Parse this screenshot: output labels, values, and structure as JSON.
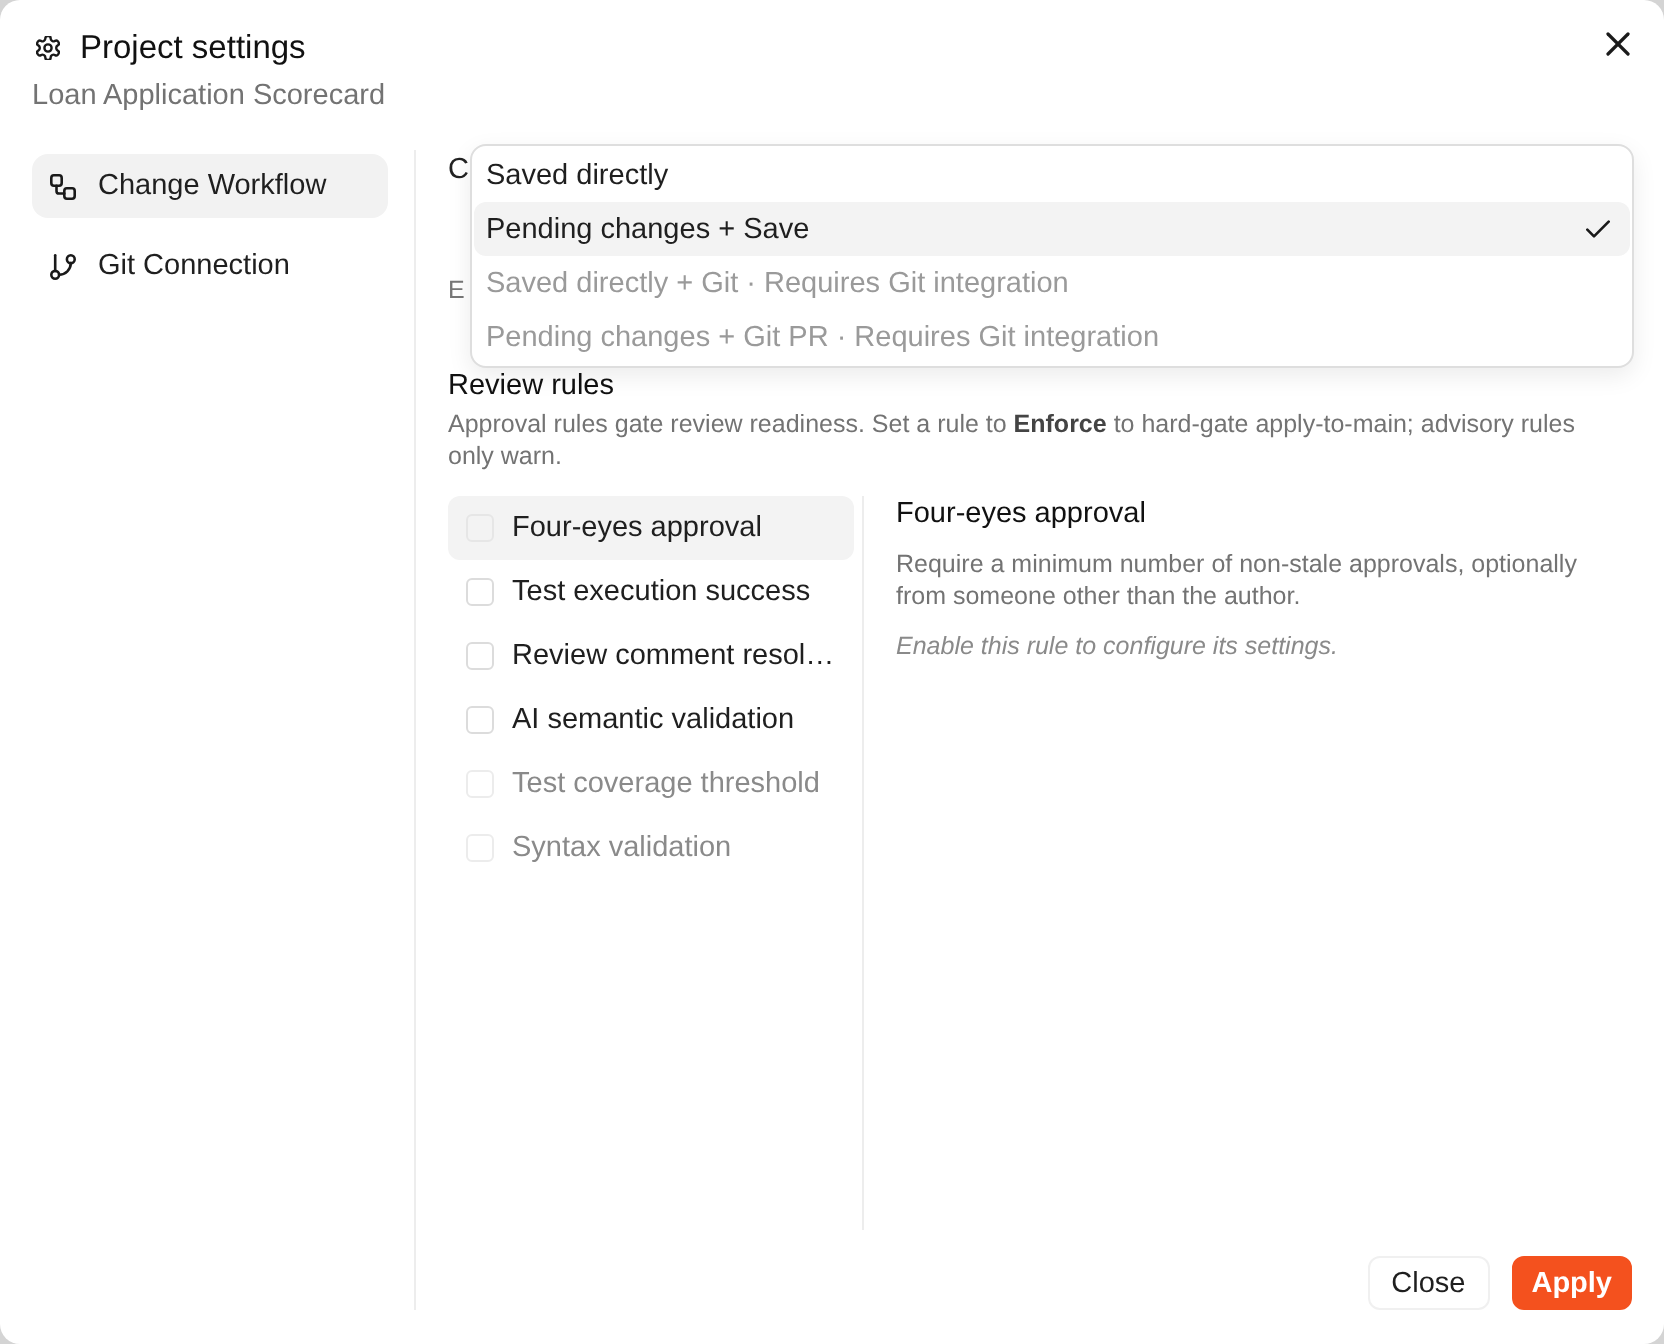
{
  "dialog": {
    "title": "Project settings",
    "subtitle": "Loan Application Scorecard"
  },
  "sidebar": {
    "items": [
      {
        "label": "Change Workflow",
        "kind": "workflow",
        "selected": true
      },
      {
        "label": "Git Connection",
        "kind": "git",
        "selected": false
      }
    ]
  },
  "workflow_field": {
    "label": "C",
    "hint": "E"
  },
  "dropdown": {
    "options": [
      {
        "label": "Saved directly",
        "selected": false,
        "disabled": false
      },
      {
        "label": "Pending changes + Save",
        "selected": true,
        "disabled": false
      },
      {
        "label": "Saved directly + Git · Requires Git integration",
        "selected": false,
        "disabled": true
      },
      {
        "label": "Pending changes + Git PR · Requires Git integration",
        "selected": false,
        "disabled": true
      }
    ]
  },
  "review_rules": {
    "title": "Review rules",
    "description": "Approval rules gate review readiness. Set a rule to **Enforce** to hard-gate apply-to-main; advisory rules only warn.",
    "rules": [
      {
        "label": "Four-eyes approval",
        "selected": true,
        "checked": false,
        "disabled": false
      },
      {
        "label": "Test execution success",
        "selected": false,
        "checked": false,
        "disabled": false
      },
      {
        "label": "Review comment resol…",
        "selected": false,
        "checked": false,
        "disabled": false
      },
      {
        "label": "AI semantic validation",
        "selected": false,
        "checked": false,
        "disabled": false
      },
      {
        "label": "Test coverage threshold",
        "selected": false,
        "checked": false,
        "disabled": true
      },
      {
        "label": "Syntax validation",
        "selected": false,
        "checked": false,
        "disabled": true
      }
    ]
  },
  "rule_detail": {
    "title": "Four-eyes approval",
    "description": "Require a minimum number of non-stale approvals, optionally from someone other than the author.",
    "note": "Enable this rule to configure its settings."
  },
  "footer": {
    "buttons": [
      {
        "label": "Close",
        "kind": "secondary"
      },
      {
        "label": "Apply",
        "kind": "primary"
      }
    ]
  }
}
